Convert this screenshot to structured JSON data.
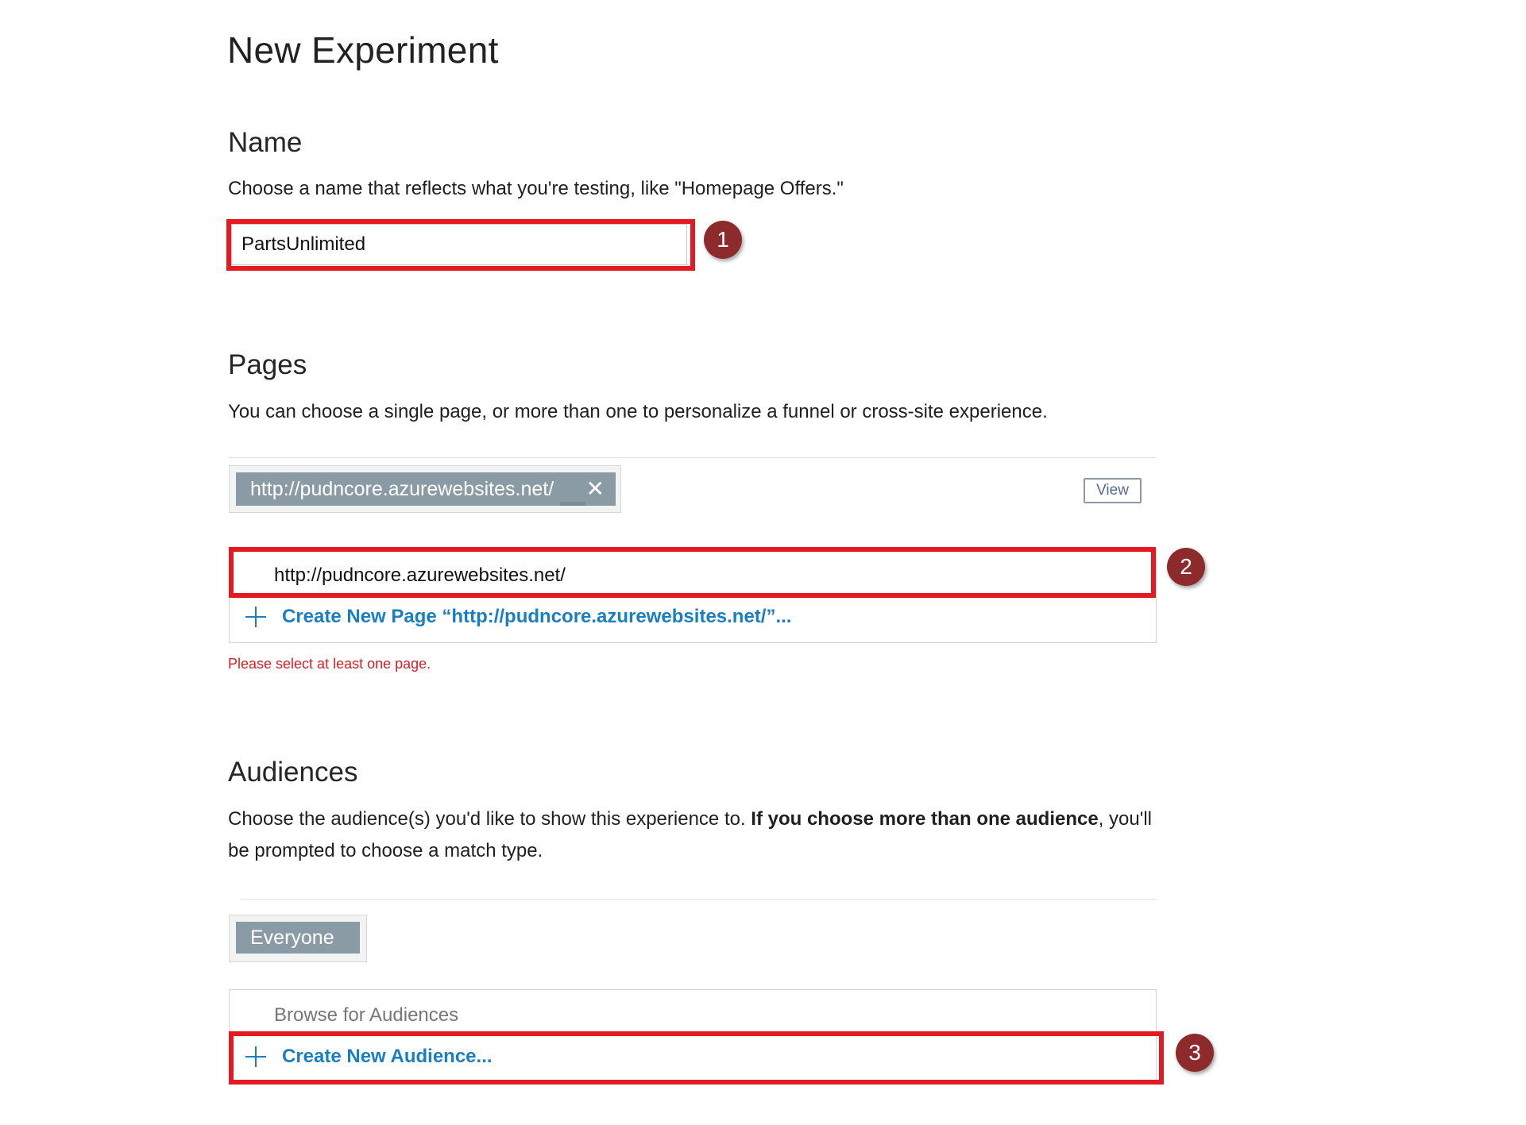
{
  "page_title": "New Experiment",
  "name_section": {
    "heading": "Name",
    "description": "Choose a name that reflects what you're testing, like \"Homepage Offers.\"",
    "input_value": "PartsUnlimited"
  },
  "pages_section": {
    "heading": "Pages",
    "description": "You can choose a single page, or more than one to personalize a funnel or cross-site experience.",
    "selected_page_tag": "http://pudncore.azurewebsites.net/",
    "remove_icon": "close-icon",
    "view_label": "View",
    "search_value": "http://pudncore.azurewebsites.net/",
    "create_option": "Create New Page “http://pudncore.azurewebsites.net/”...",
    "error": "Please select at least one page."
  },
  "audiences_section": {
    "heading": "Audiences",
    "description_pre": "Choose the audience(s) you'd like to show this experience to. ",
    "description_bold": "If you choose more than one audience",
    "description_post": ", you'll be prompted to choose a match type.",
    "selected_audience_tag": "Everyone",
    "browse_placeholder": "Browse for Audiences",
    "create_option": "Create New Audience..."
  },
  "step_badges": [
    "1",
    "2",
    "3"
  ],
  "colors": {
    "highlight": "#e21b23",
    "badge": "#8c2a2c",
    "link": "#1a7fc1",
    "tag": "#8a9ba6",
    "error": "#d32027"
  }
}
